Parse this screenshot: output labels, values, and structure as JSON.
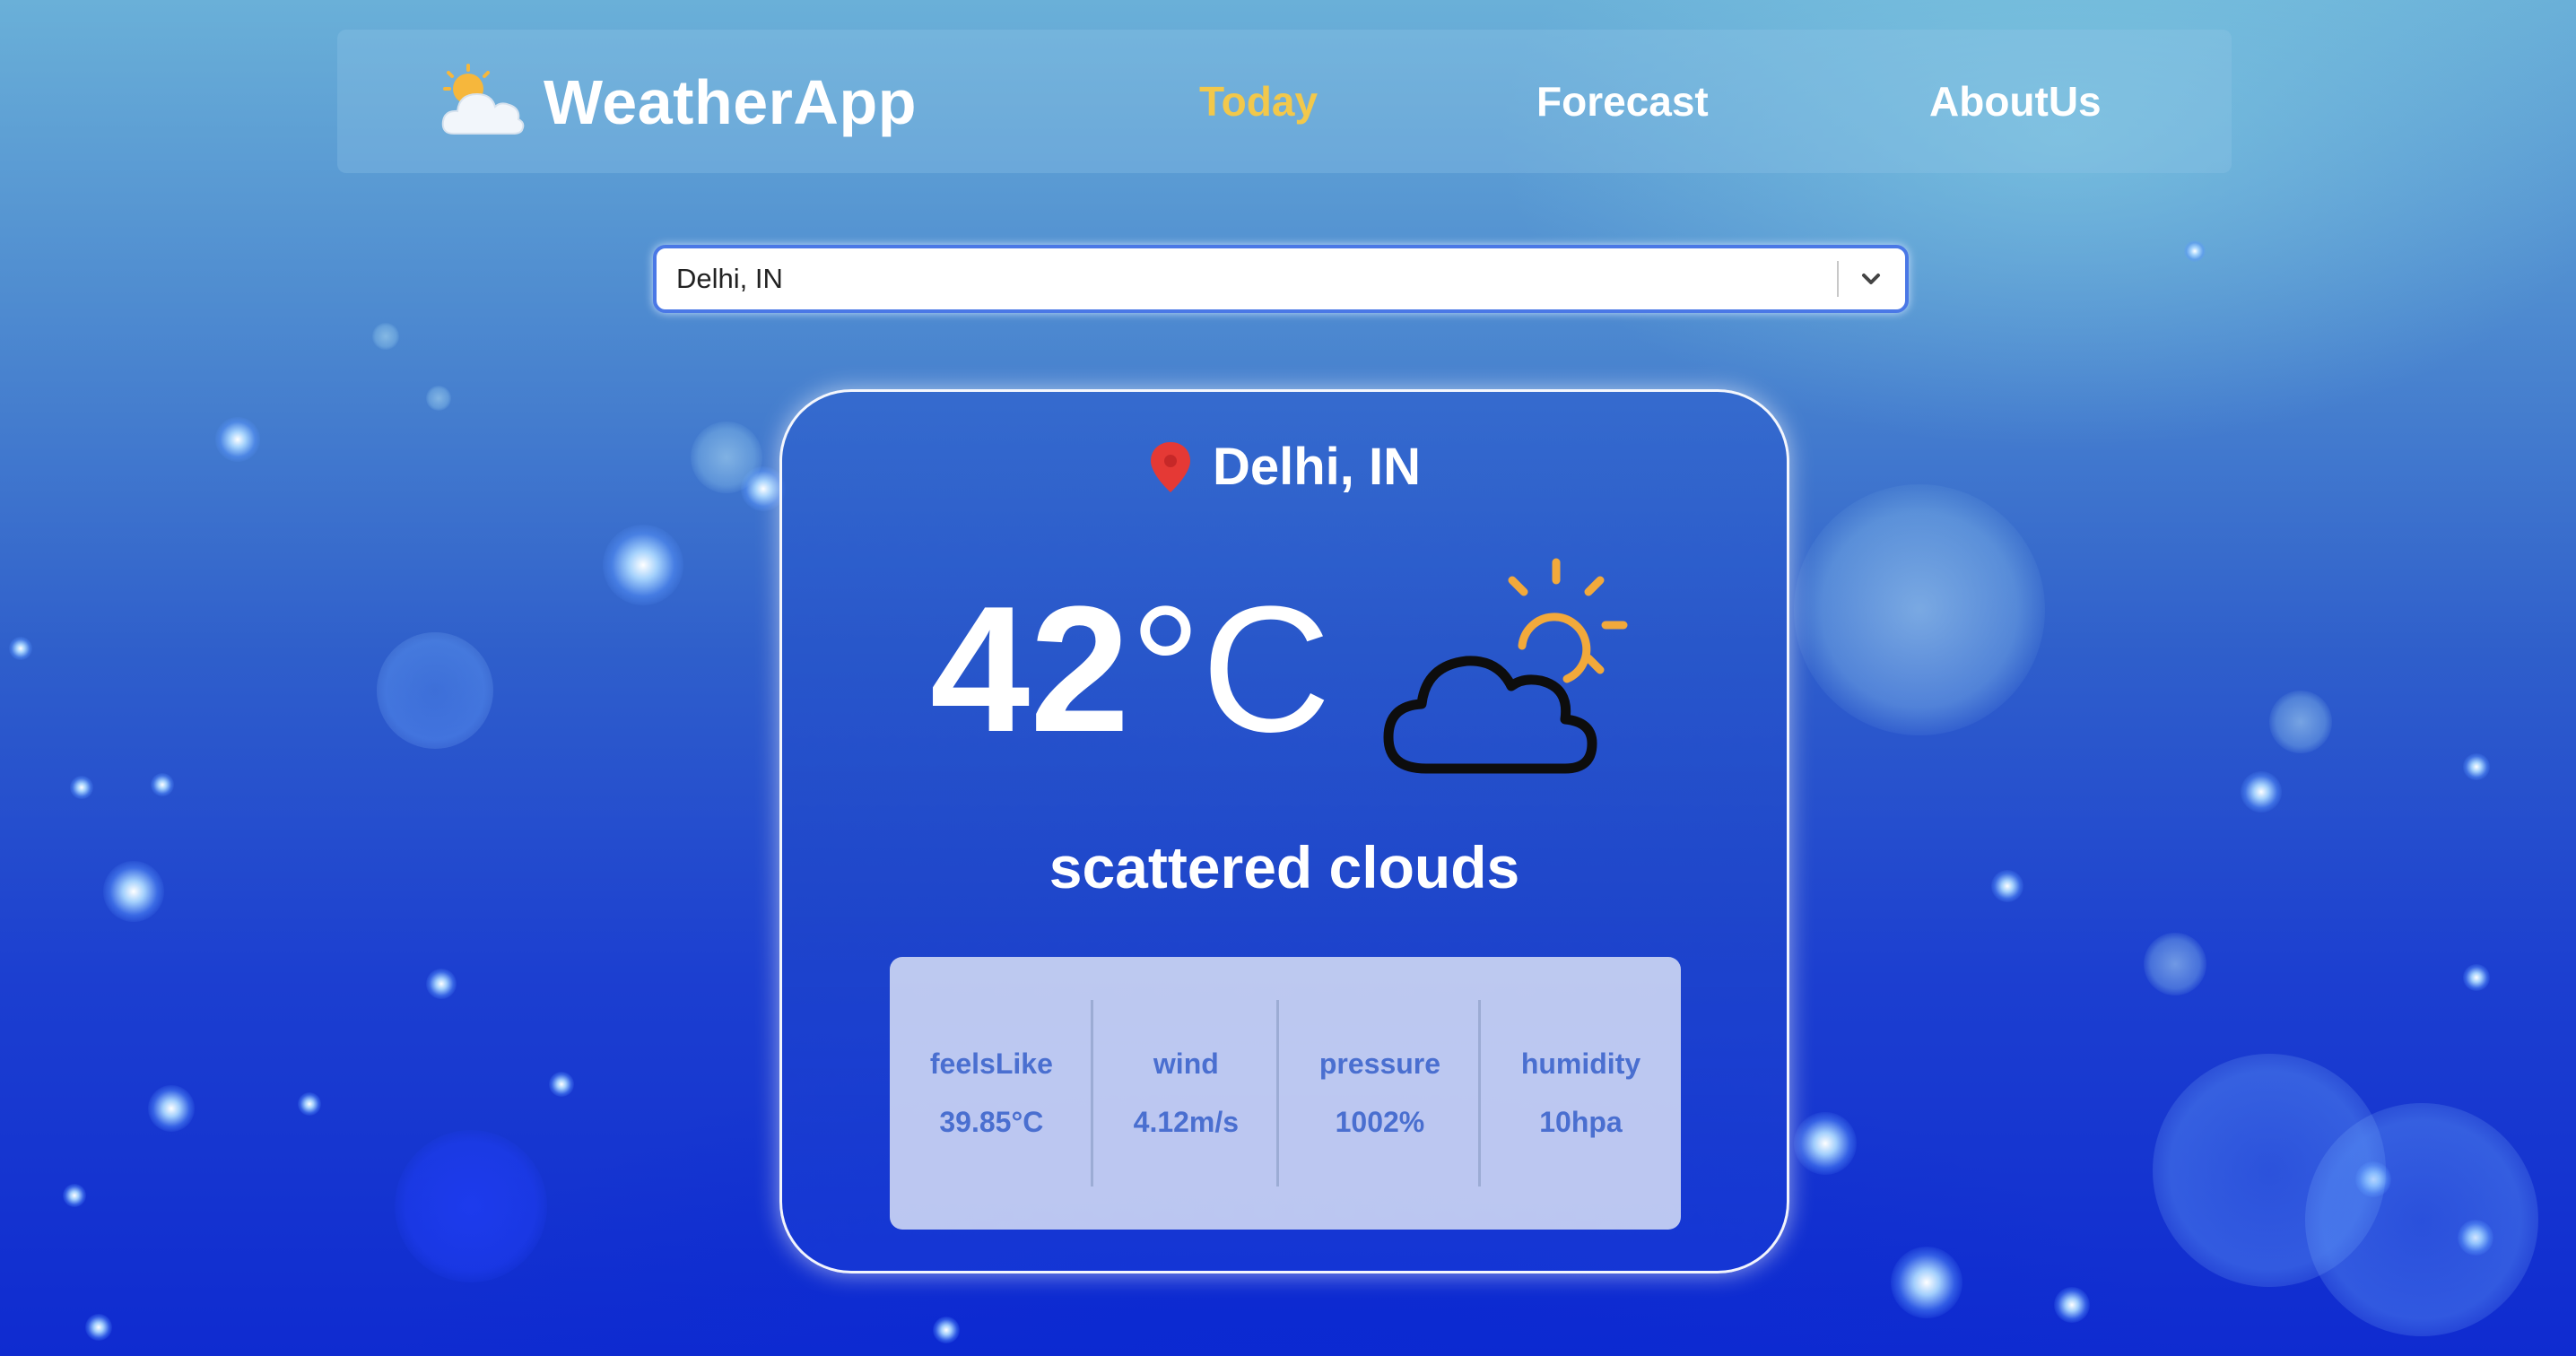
{
  "nav": {
    "brand": "WeatherApp",
    "brand_icon": "sun-behind-cloud-icon",
    "links": [
      {
        "label": "Today",
        "active": true
      },
      {
        "label": "Forecast",
        "active": false
      },
      {
        "label": "AboutUs",
        "active": false
      }
    ],
    "active_color": "#f2c84b"
  },
  "search": {
    "selected": "Delhi, IN",
    "icon": "chevron-down-icon"
  },
  "card": {
    "location": "Delhi, IN",
    "location_icon": "map-pin-icon",
    "temperature": "42",
    "unit": "°C",
    "condition_icon": "sun-behind-cloud-icon",
    "description": "scattered clouds",
    "stats": [
      {
        "label": "feelsLike",
        "value": "39.85°C"
      },
      {
        "label": "wind",
        "value": "4.12m/s"
      },
      {
        "label": "pressure",
        "value": "1002%"
      },
      {
        "label": "humidity",
        "value": "10hpa"
      }
    ]
  },
  "colors": {
    "pin": "#e53935",
    "sun": "#f2a93b",
    "stat_text": "#4a6fd0"
  }
}
